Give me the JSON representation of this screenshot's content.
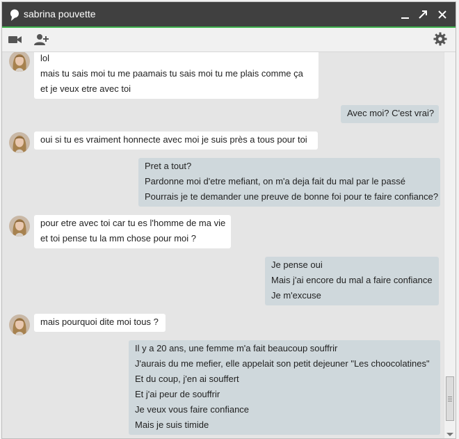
{
  "window": {
    "title": "sabrina pouvette"
  },
  "colors": {
    "titlebar": "#404040",
    "accent": "#3fb34f",
    "incoming_bubble": "#ffffff",
    "outgoing_bubble": "#cfd8dc",
    "background": "#e5e5e5"
  },
  "toolbar": {
    "icons": [
      "video-call-icon",
      "add-person-icon",
      "settings-icon"
    ]
  },
  "titlebar_icons": [
    "chat-bubble-icon",
    "minimize-icon",
    "pop-out-icon",
    "close-icon"
  ],
  "messages": [
    {
      "sender": "them",
      "lines": [
        "lol",
        "mais tu sais moi tu me paamais tu sais moi tu me plais comme ça",
        "et je veux etre avec toi"
      ]
    },
    {
      "sender": "me",
      "lines": [
        "Avec moi? C'est vrai?"
      ]
    },
    {
      "sender": "them",
      "lines": [
        "oui si tu es vraiment honnecte avec moi je suis près a tous pour toi"
      ]
    },
    {
      "sender": "me",
      "lines": [
        "Pret a tout?",
        "Pardonne moi d'etre mefiant, on m'a deja fait du mal par le passé",
        "Pourrais je te demander une preuve de bonne foi pour te faire confiance?"
      ]
    },
    {
      "sender": "them",
      "lines": [
        "pour etre avec toi car tu es l'homme de ma vie",
        "et toi pense tu la mm chose pour moi ?"
      ]
    },
    {
      "sender": "me",
      "lines": [
        "Je pense oui",
        "Mais j'ai encore du mal a faire confiance",
        "Je m'excuse"
      ]
    },
    {
      "sender": "them",
      "lines": [
        "mais pourquoi dite moi tous ?"
      ]
    },
    {
      "sender": "me",
      "lines": [
        "Il y a 20 ans, une femme m'a fait beaucoup souffrir",
        "J'aurais du me mefier, elle appelait son petit dejeuner \"Les choocolatines\"",
        "Et du coup, j'en ai souffert",
        "Et j'ai peur de souffrir",
        "Je veux vous faire confiance",
        "Mais je suis timide"
      ]
    }
  ]
}
